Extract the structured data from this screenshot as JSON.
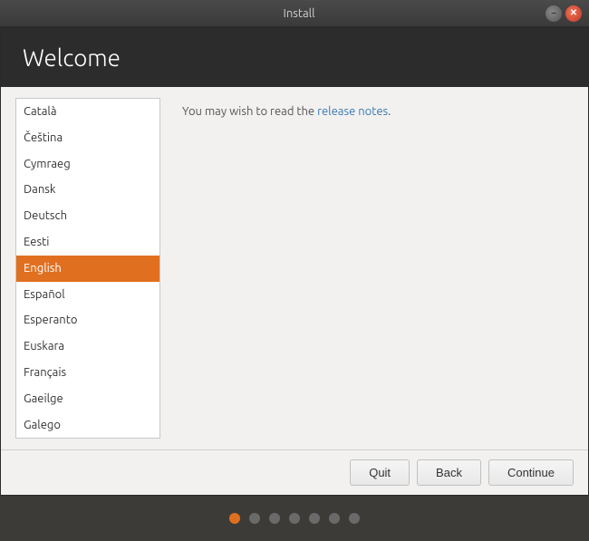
{
  "titlebar": {
    "title": "Install",
    "minimize_label": "–",
    "close_label": "✕"
  },
  "header": {
    "title": "Welcome"
  },
  "languages": [
    {
      "id": "catala",
      "label": "Català",
      "selected": false
    },
    {
      "id": "cestina",
      "label": "Čeština",
      "selected": false
    },
    {
      "id": "cymraeg",
      "label": "Cymraeg",
      "selected": false
    },
    {
      "id": "dansk",
      "label": "Dansk",
      "selected": false
    },
    {
      "id": "deutsch",
      "label": "Deutsch",
      "selected": false
    },
    {
      "id": "eesti",
      "label": "Eesti",
      "selected": false
    },
    {
      "id": "english",
      "label": "English",
      "selected": true
    },
    {
      "id": "espanol",
      "label": "Español",
      "selected": false
    },
    {
      "id": "esperanto",
      "label": "Esperanto",
      "selected": false
    },
    {
      "id": "euskara",
      "label": "Euskara",
      "selected": false
    },
    {
      "id": "francais",
      "label": "Français",
      "selected": false
    },
    {
      "id": "gaeilge",
      "label": "Gaeilge",
      "selected": false
    },
    {
      "id": "galego",
      "label": "Galego",
      "selected": false
    }
  ],
  "content": {
    "release_notes_prefix": "You may wish to read the ",
    "release_notes_link": "release notes",
    "release_notes_suffix": "."
  },
  "footer": {
    "quit_label": "Quit",
    "back_label": "Back",
    "continue_label": "Continue"
  },
  "dots": {
    "count": 7,
    "active_index": 0
  }
}
